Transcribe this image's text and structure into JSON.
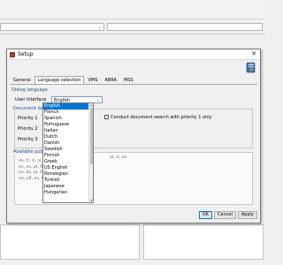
{
  "dialog": {
    "title": "Setup",
    "close_glyph": "✕",
    "tabs": [
      {
        "label": "General"
      },
      {
        "label": "Language selection",
        "active": true
      },
      {
        "label": "VMS"
      },
      {
        "label": "ABRA"
      },
      {
        "label": "MSS"
      }
    ],
    "dialog_language_label": "Dialog language",
    "user_interface_label": "User interface",
    "user_interface_value": "English",
    "document_languages_label": "Document lan",
    "priority_labels": [
      "Priority 1",
      "Priority 2",
      "Priority 3"
    ],
    "conduct_search_label": "Conduct document search with priority 1 only",
    "available_label": "Available publi",
    "available_lines": [
      "de, fr, it, nl, es,",
      "en, es, pt, fi, sh",
      "en, ko, pl, fi, sh",
      "en, ufl, en, fr, zh"
    ],
    "available_right": "al, sl, en",
    "dropdown": {
      "selected": "English",
      "items": [
        "English",
        "French",
        "Spanish",
        "Portuguese",
        "Italian",
        "Dutch",
        "Danish",
        "Swedish",
        "Finnish",
        "Greek",
        "US English",
        "Norwegian",
        "Turkish",
        "Japanese",
        "Hungarian"
      ]
    },
    "buttons": {
      "ok": "OK",
      "cancel": "Cancel",
      "apply": "Apply"
    }
  },
  "colors": {
    "accent": "#0078d7",
    "section_label": "#1f4e9c"
  },
  "icons": [
    "setup-app-icon",
    "book-logo-icon",
    "close-icon",
    "chevron-down-icon"
  ]
}
